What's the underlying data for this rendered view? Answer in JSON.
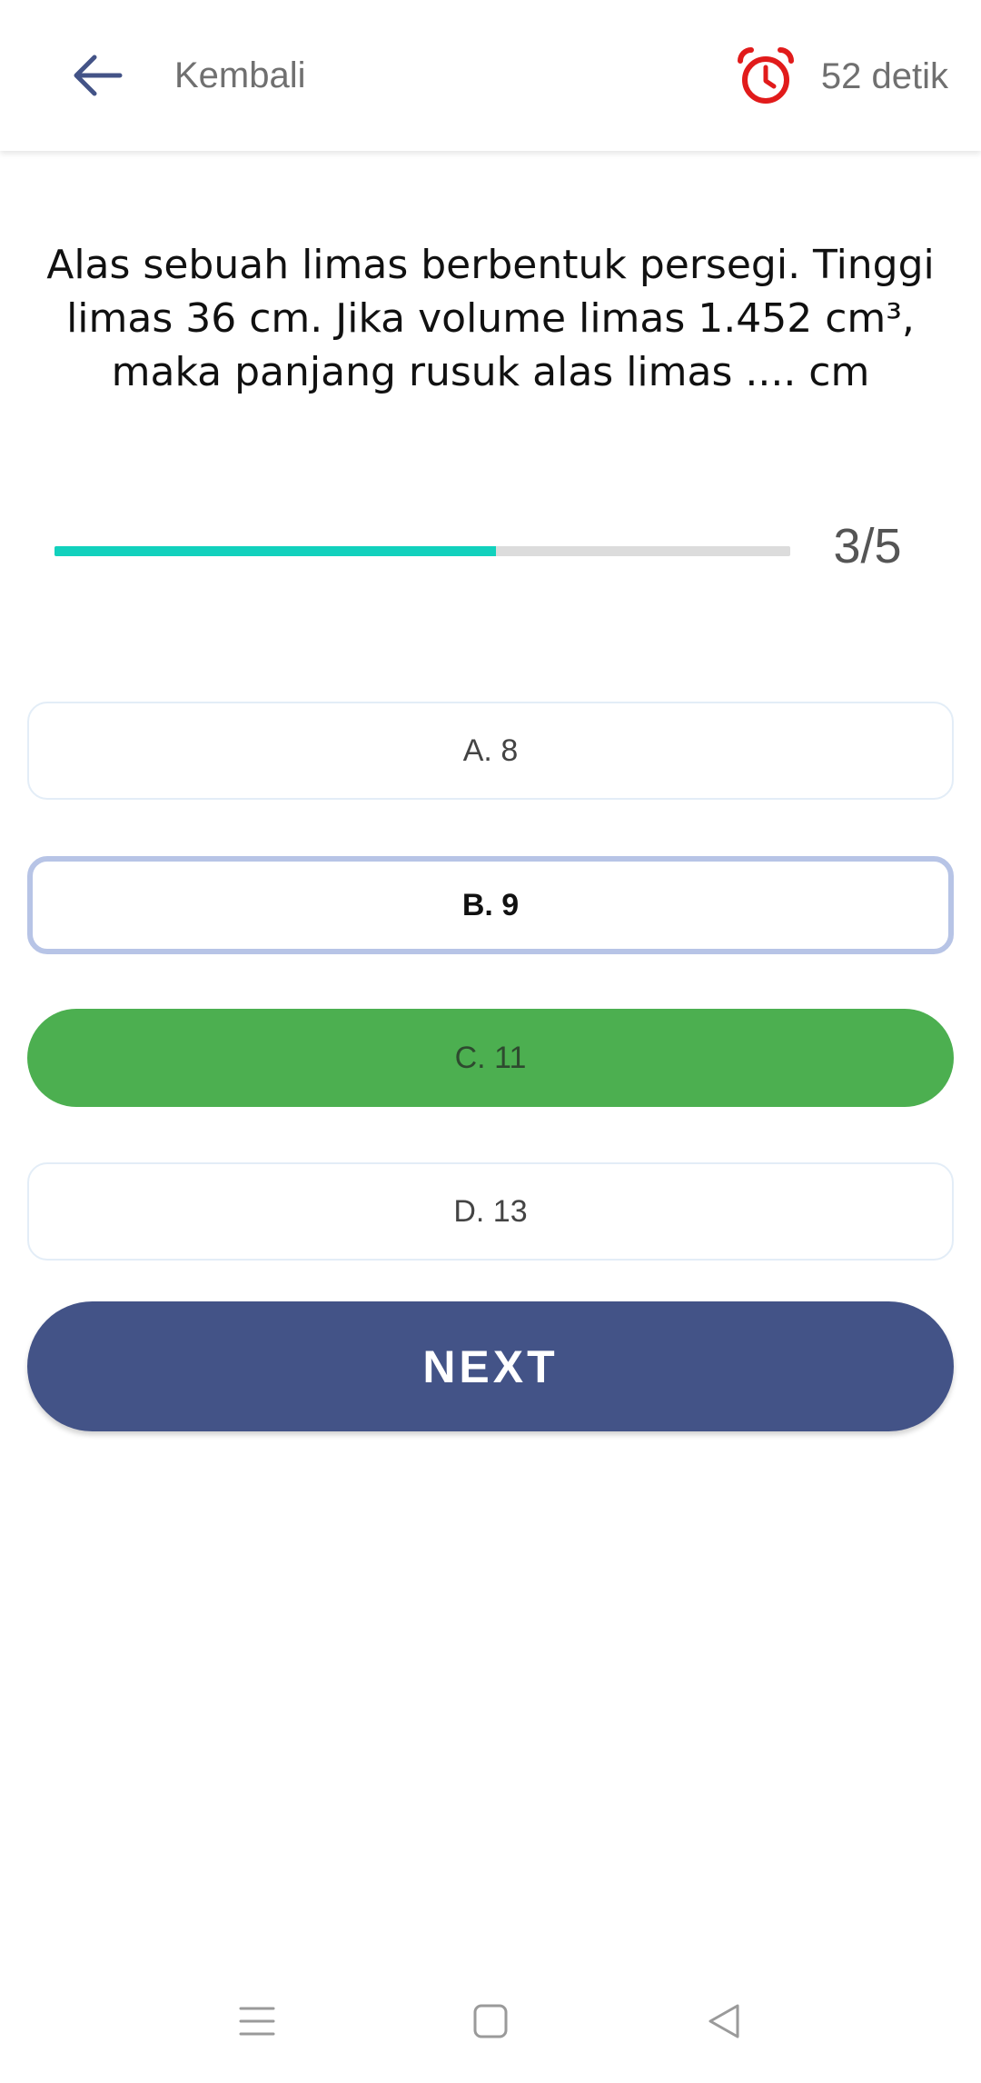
{
  "header": {
    "back_label": "Kembali",
    "back_icon": "arrow-left-icon",
    "timer_label": "52 detik",
    "timer_icon": "alarm-clock-icon"
  },
  "question": {
    "text": "Alas sebuah limas berbentuk persegi. Tinggi limas 36 cm. Jika volume limas 1.452 cm³, maka panjang rusuk alas limas .... cm"
  },
  "progress": {
    "current": 3,
    "total": 5,
    "label": "3/5",
    "fraction": 0.6
  },
  "options": [
    {
      "label": "A. 8",
      "state": "default"
    },
    {
      "label": "B. 9",
      "state": "selected"
    },
    {
      "label": "C. 11",
      "state": "correct"
    },
    {
      "label": "D. 13",
      "state": "default"
    }
  ],
  "next_button": {
    "label": "NEXT"
  },
  "nav_bar": {
    "icons": [
      "menu-icon",
      "home-square-icon",
      "back-triangle-icon"
    ]
  },
  "colors": {
    "primary": "#435387",
    "progress": "#12d1bd",
    "correct": "#4caf50",
    "selected_border": "#b7c4e6",
    "timer_red": "#e11b1b"
  }
}
